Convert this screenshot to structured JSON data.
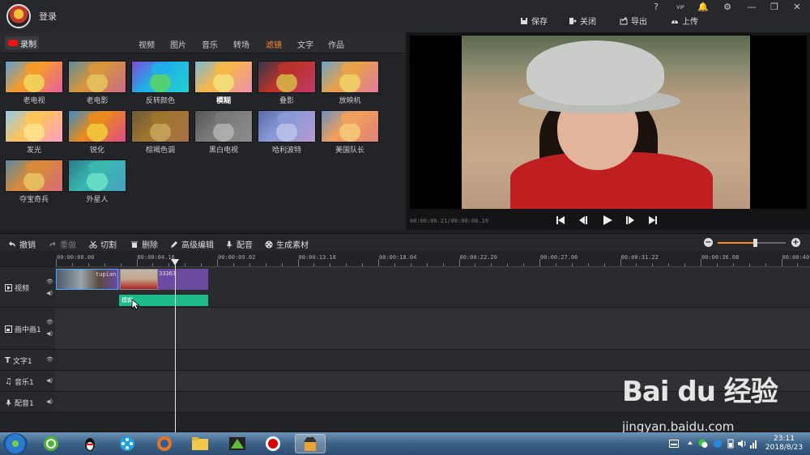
{
  "app": {
    "login_label": "登录"
  },
  "window_controls": [
    "?",
    "VIP",
    "🔔",
    "⚙",
    "—",
    "❐",
    "✕"
  ],
  "top_actions": [
    {
      "label": "保存",
      "icon": "save-icon"
    },
    {
      "label": "关闭",
      "icon": "close-project-icon"
    },
    {
      "label": "导出",
      "icon": "export-icon"
    },
    {
      "label": "上传",
      "icon": "upload-icon"
    }
  ],
  "library": {
    "record_label": "录制",
    "tabs": [
      "视频",
      "图片",
      "音乐",
      "转场",
      "滤镜",
      "文字",
      "作品"
    ],
    "active_tab": "滤镜",
    "filters": [
      "老电视",
      "老电影",
      "反转颜色",
      "模糊",
      "叠影",
      "放映机",
      "发光",
      "锐化",
      "棕褐色调",
      "黑白电视",
      "哈利波特",
      "美国队长",
      "夺宝奇兵",
      "外星人"
    ],
    "selected_filter": "模糊"
  },
  "preview": {
    "time_display": "00:00:06.21/00:00:08.19"
  },
  "edit_toolbar": [
    {
      "label": "撤销",
      "icon": "undo-icon",
      "enabled": true
    },
    {
      "label": "重做",
      "icon": "redo-icon",
      "enabled": false
    },
    {
      "label": "切割",
      "icon": "scissors-icon",
      "enabled": true
    },
    {
      "label": "删除",
      "icon": "trash-icon",
      "enabled": true
    },
    {
      "label": "高级编辑",
      "icon": "pencil-icon",
      "enabled": true
    },
    {
      "label": "配音",
      "icon": "microphone-icon",
      "enabled": true
    },
    {
      "label": "生成素材",
      "icon": "film-reel-icon",
      "enabled": true
    }
  ],
  "zoom": {
    "level": 0.55
  },
  "ruler_ticks": [
    "00:00:00.00",
    "00:00:04.16",
    "00:00:09.02",
    "00:00:13.18",
    "00:00:18.04",
    "00:00:22.20",
    "00:00:27.06",
    "00:00:31.22",
    "00:00:36.08",
    "00:00:40.24"
  ],
  "tracks": [
    {
      "name": "视频",
      "icon": "play-icon"
    },
    {
      "name": "画中画1",
      "icon": "pip-icon"
    },
    {
      "name": "文字1",
      "icon": "text-icon"
    },
    {
      "name": "音乐1",
      "icon": "music-icon"
    },
    {
      "name": "配音1",
      "icon": "microphone-icon"
    }
  ],
  "clips": {
    "clip1_label": "tupian",
    "clip2_label": "33363",
    "filter_clip_label": "模糊"
  },
  "watermark": {
    "brand": "Bai  du 经验",
    "url": "jingyan.baidu.com"
  },
  "taskbar": {
    "time": "23:11",
    "date": "2018/8/23"
  }
}
